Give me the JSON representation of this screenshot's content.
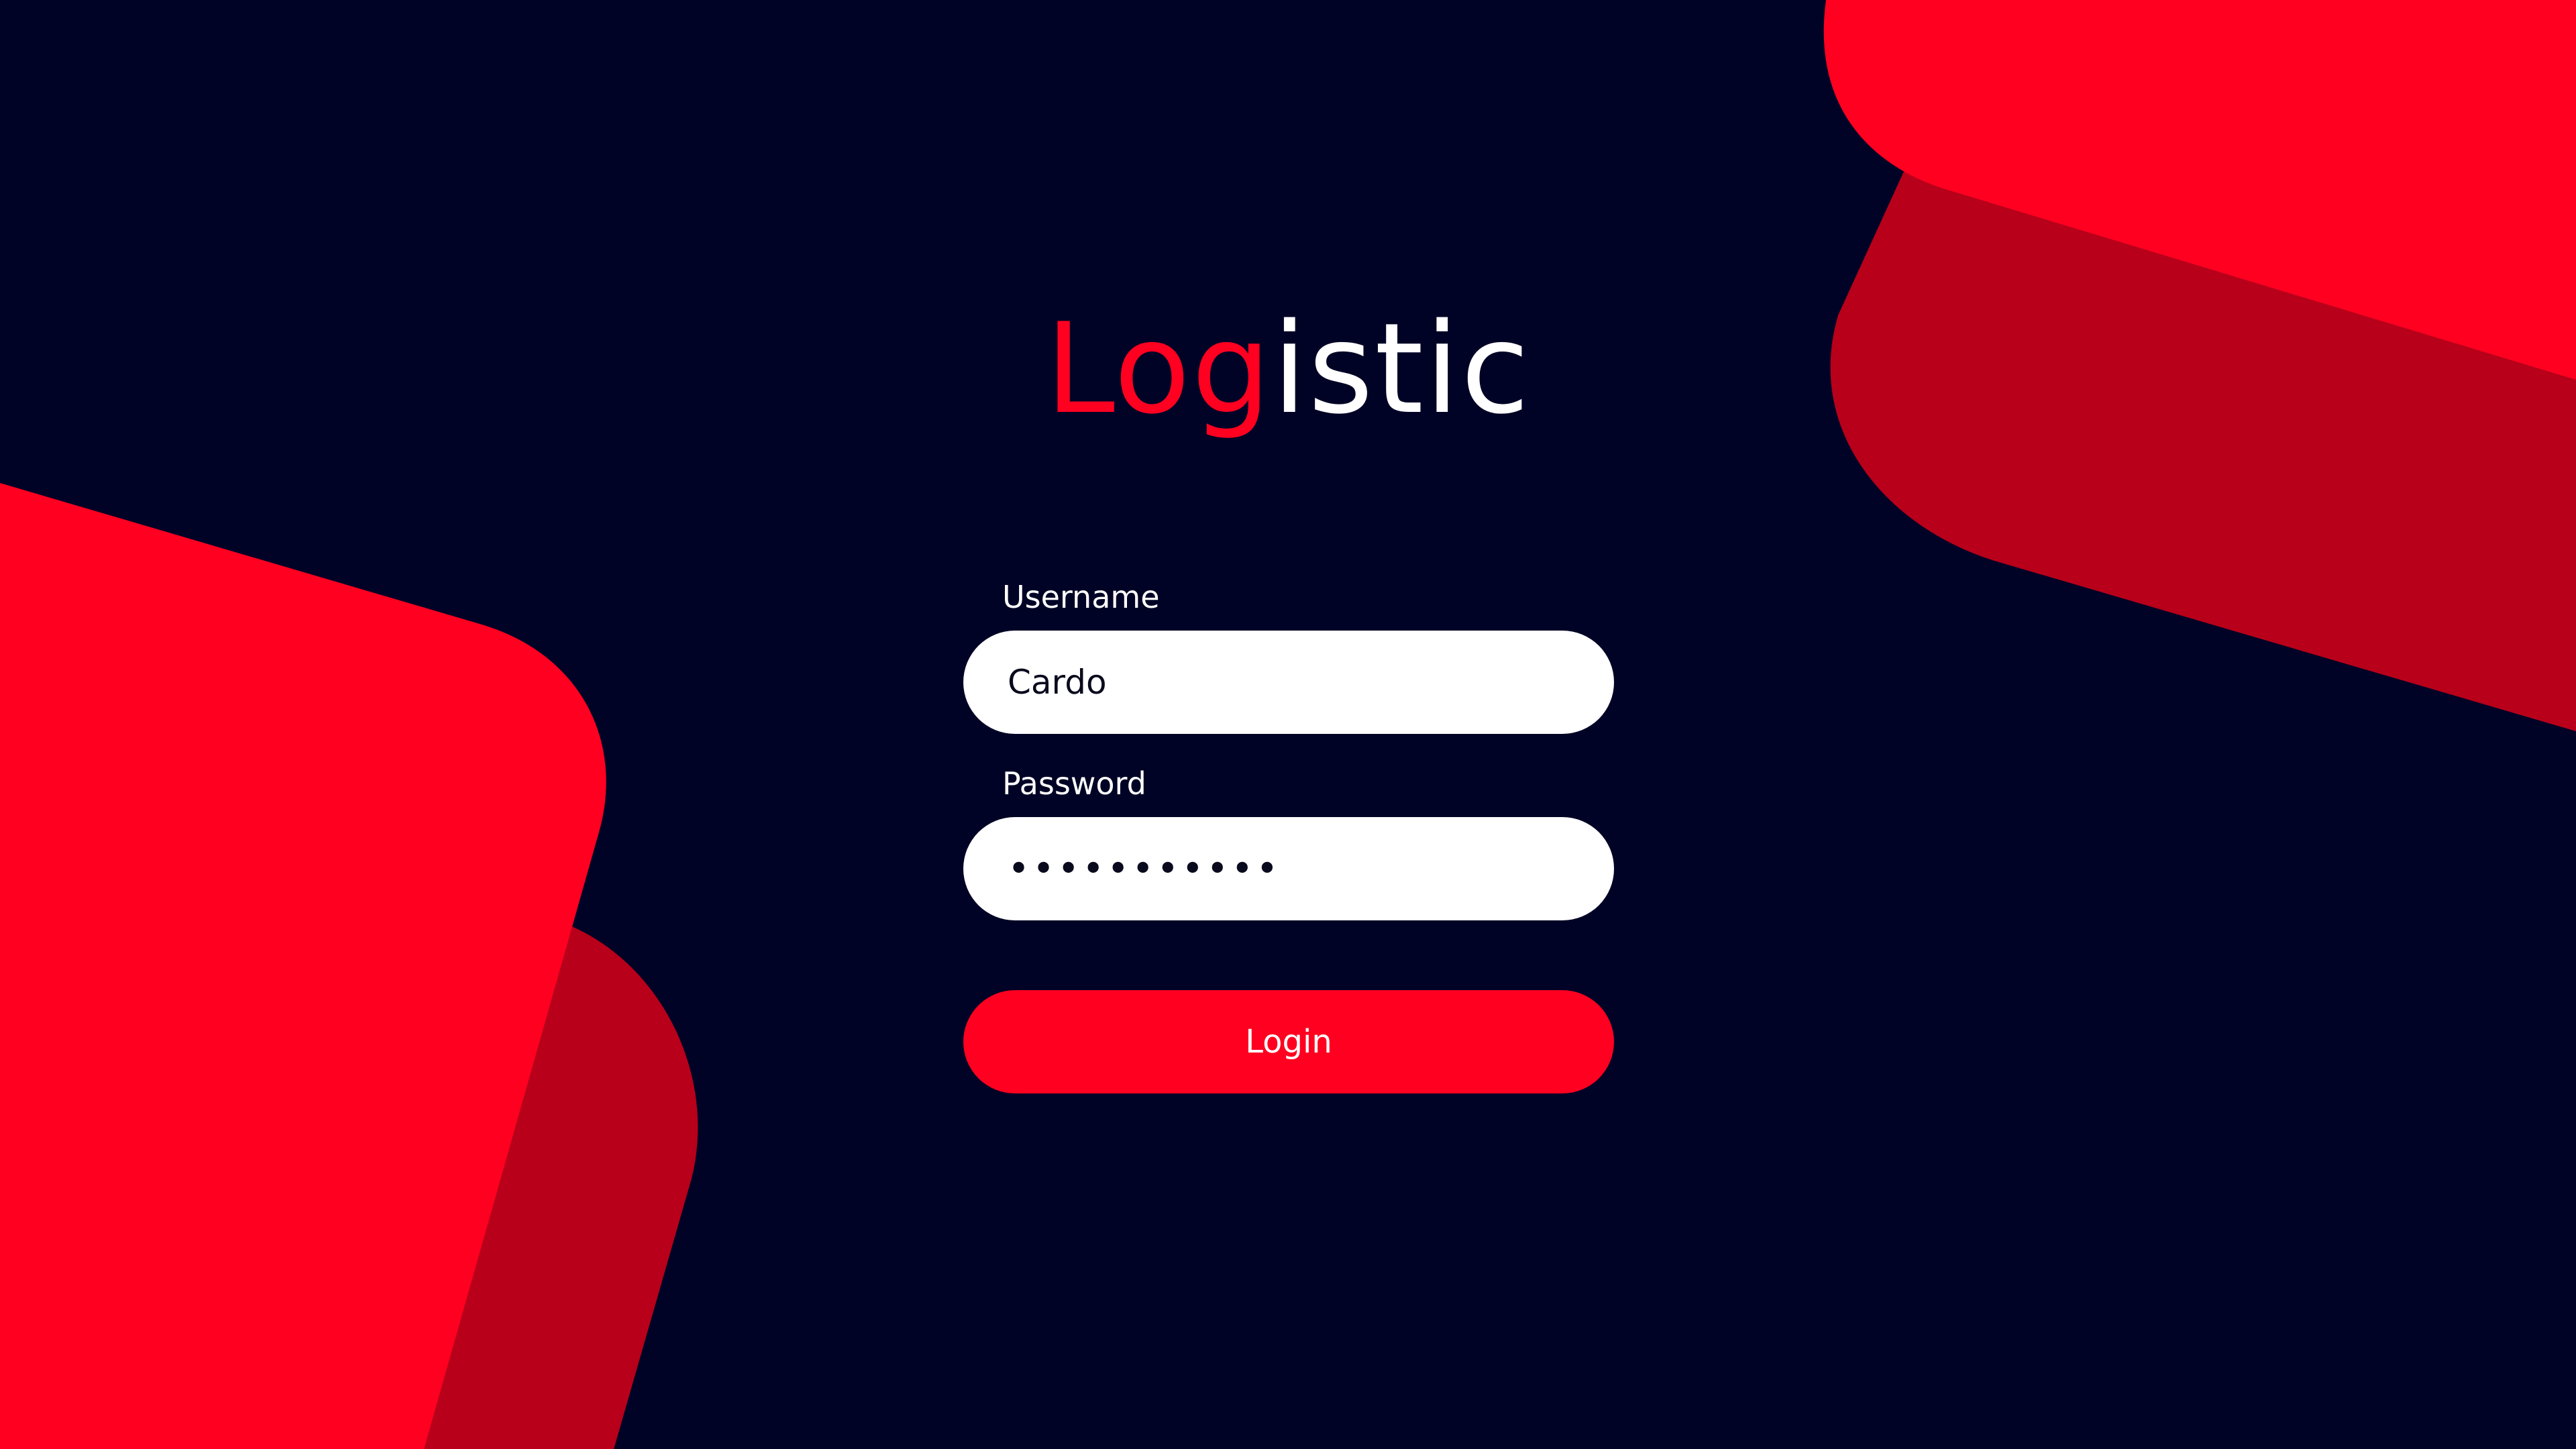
{
  "brand": {
    "part_red": "Log",
    "part_white": "istic",
    "accent_color": "#ff0020",
    "background_color": "#000325"
  },
  "form": {
    "username_label": "Username",
    "username_value": "Cardo",
    "password_label": "Password",
    "password_value": "•••••••••••",
    "login_label": "Login"
  }
}
